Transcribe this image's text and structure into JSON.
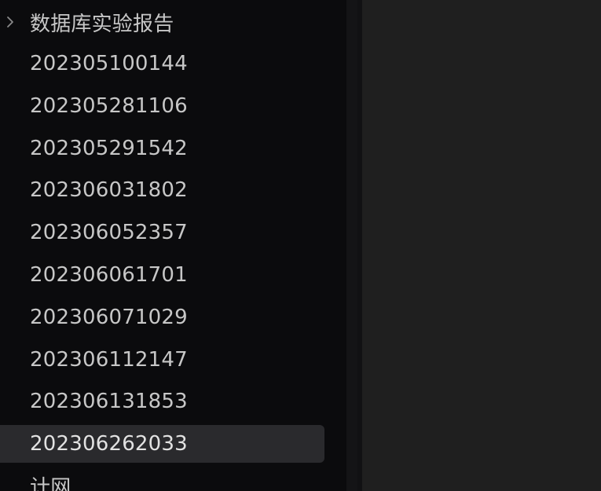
{
  "tree": {
    "folder": {
      "label": "数据库实验报告",
      "icon": "chevron-right-icon"
    },
    "items": [
      "202305100144",
      "202305281106",
      "202305291542",
      "202306031802",
      "202306052357",
      "202306061701",
      "202306071029",
      "202306112147",
      "202306131853",
      "202306262033",
      "计网"
    ],
    "selected_index": 9
  },
  "colors": {
    "sidebar_bg": "#0b0b0d",
    "main_bg": "#1f1f1f",
    "text": "#c7c7c7",
    "selected_bg": "#2a2a2d"
  }
}
